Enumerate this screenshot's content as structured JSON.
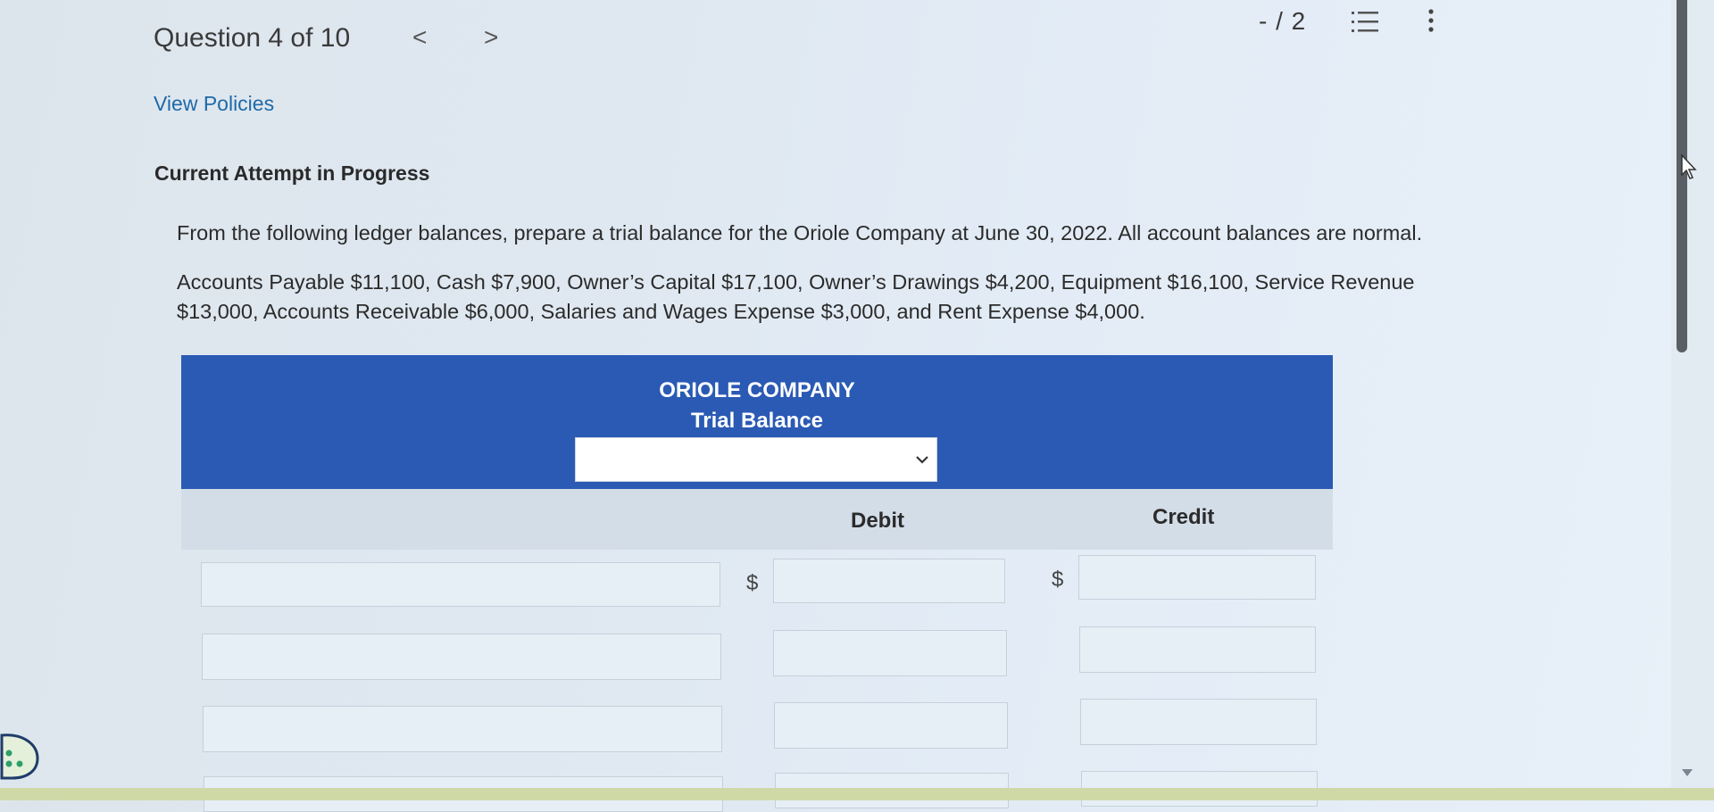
{
  "header": {
    "question_label": "Question 4 of 10",
    "prev_label": "<",
    "next_label": ">",
    "score": "- / 2",
    "list_icon": "list-icon",
    "more_icon": "more-vertical-icon"
  },
  "links": {
    "view_policies": "View Policies"
  },
  "status": {
    "attempt": "Current Attempt in Progress"
  },
  "question": {
    "prompt": "From the following ledger balances, prepare a trial balance for the Oriole Company at June 30, 2022. All account balances are normal.",
    "data": "Accounts Payable $11,100, Cash $7,900, Owner’s Capital $17,100, Owner’s Drawings $4,200, Equipment $16,100, Service Revenue $13,000, Accounts Receivable $6,000, Salaries and Wages Expense $3,000, and Rent Expense $4,000."
  },
  "trial_balance": {
    "company": "ORIOLE COMPANY",
    "title": "Trial Balance",
    "date_selected": "",
    "col_debit": "Debit",
    "col_credit": "Credit",
    "currency_symbol": "$"
  },
  "colors": {
    "header_blue": "#2a5ab4",
    "link_blue": "#1e6aa8",
    "subheader_gray": "#d3dde8"
  }
}
